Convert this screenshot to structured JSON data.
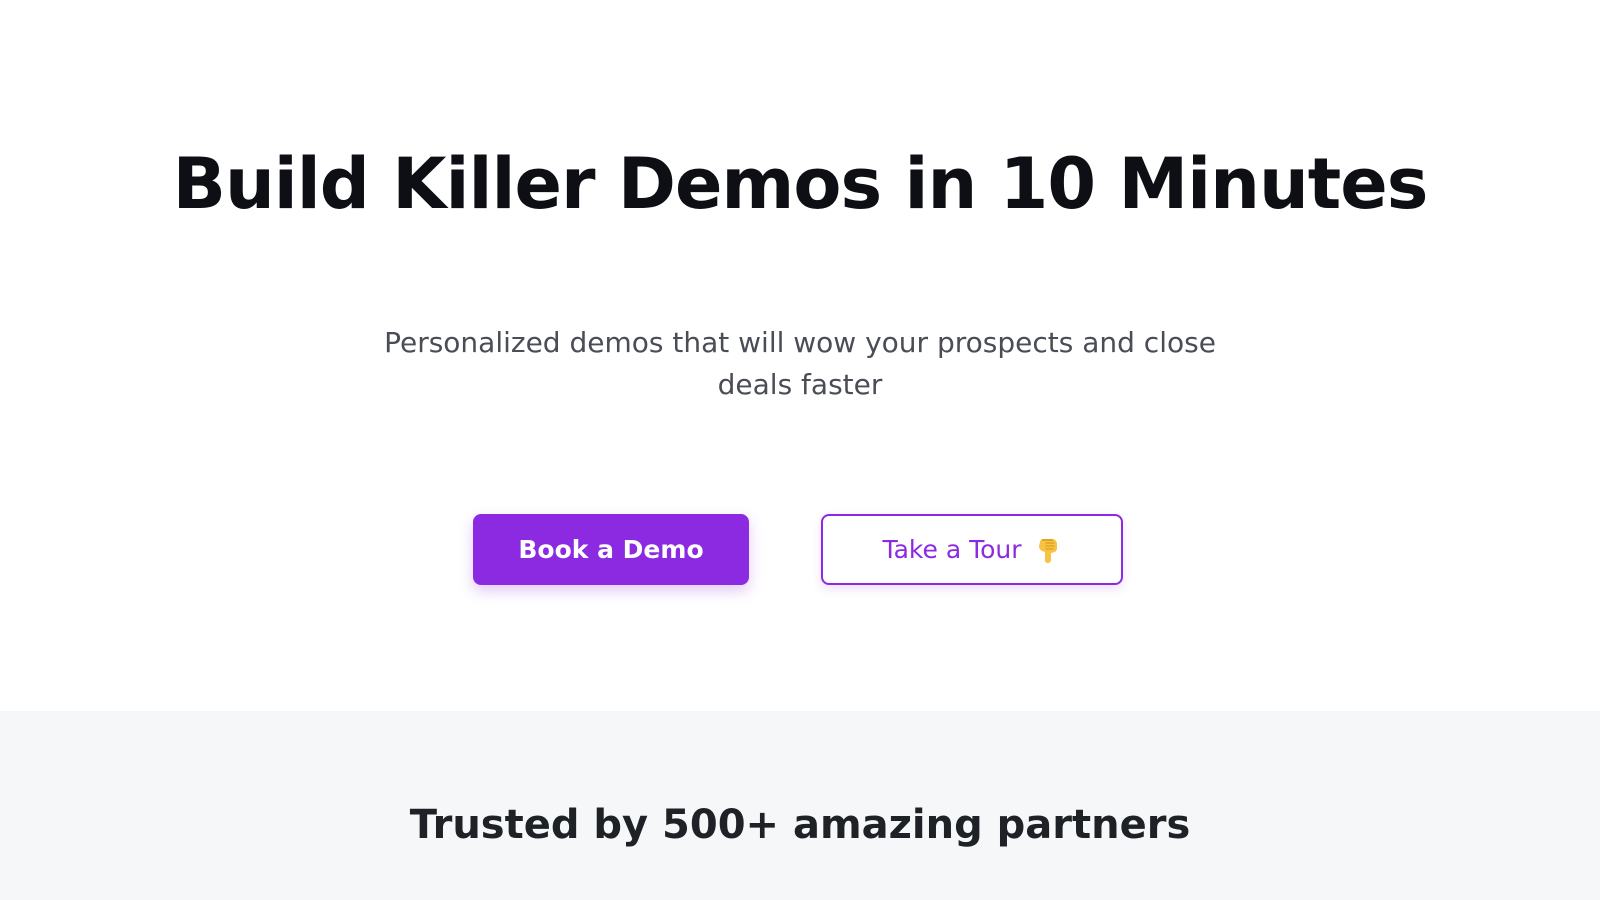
{
  "hero": {
    "title": "Build Killer Demos in 10 Minutes",
    "subtitle": "Personalized demos that will wow your prospects and close deals faster",
    "primary_button": {
      "label": "Book a Demo"
    },
    "secondary_button": {
      "label": "Take a Tour",
      "icon": "pointing-hand-down-icon"
    }
  },
  "partners": {
    "title": "Trusted by 500+ amazing partners"
  },
  "colors": {
    "accent": "#8b2ae0",
    "title": "#0d0f14",
    "subtitle": "#4a4d55",
    "section_bg": "#f6f7f9"
  }
}
